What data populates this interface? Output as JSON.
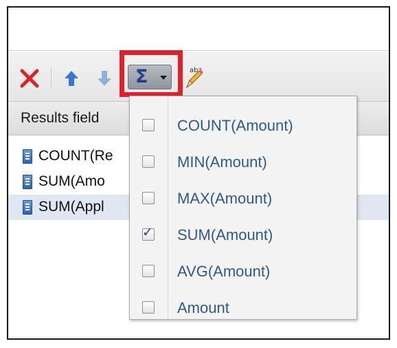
{
  "toolbar": {
    "icons": [
      "delete-icon",
      "move-up-icon",
      "move-down-icon",
      "sigma-icon",
      "chevron-down-icon",
      "spell-check-icon"
    ],
    "sum_glyph": "Σ",
    "accent_color": "#e0202a"
  },
  "header": {
    "label": "Results field"
  },
  "results": {
    "items": [
      {
        "label": "COUNT(Re",
        "selected": false
      },
      {
        "label": "SUM(Amo",
        "selected": false
      },
      {
        "label": "SUM(Appl",
        "selected": true
      }
    ],
    "selected_color": "#dfe7f2"
  },
  "dropdown": {
    "check_glyph": "✓",
    "label_color": "#2d5a8a",
    "items": [
      {
        "label": "COUNT(Amount)",
        "checked": false
      },
      {
        "label": "MIN(Amount)",
        "checked": false
      },
      {
        "label": "MAX(Amount)",
        "checked": false
      },
      {
        "label": "SUM(Amount)",
        "checked": true
      },
      {
        "label": "AVG(Amount)",
        "checked": false
      },
      {
        "label": "Amount",
        "checked": false
      }
    ]
  }
}
